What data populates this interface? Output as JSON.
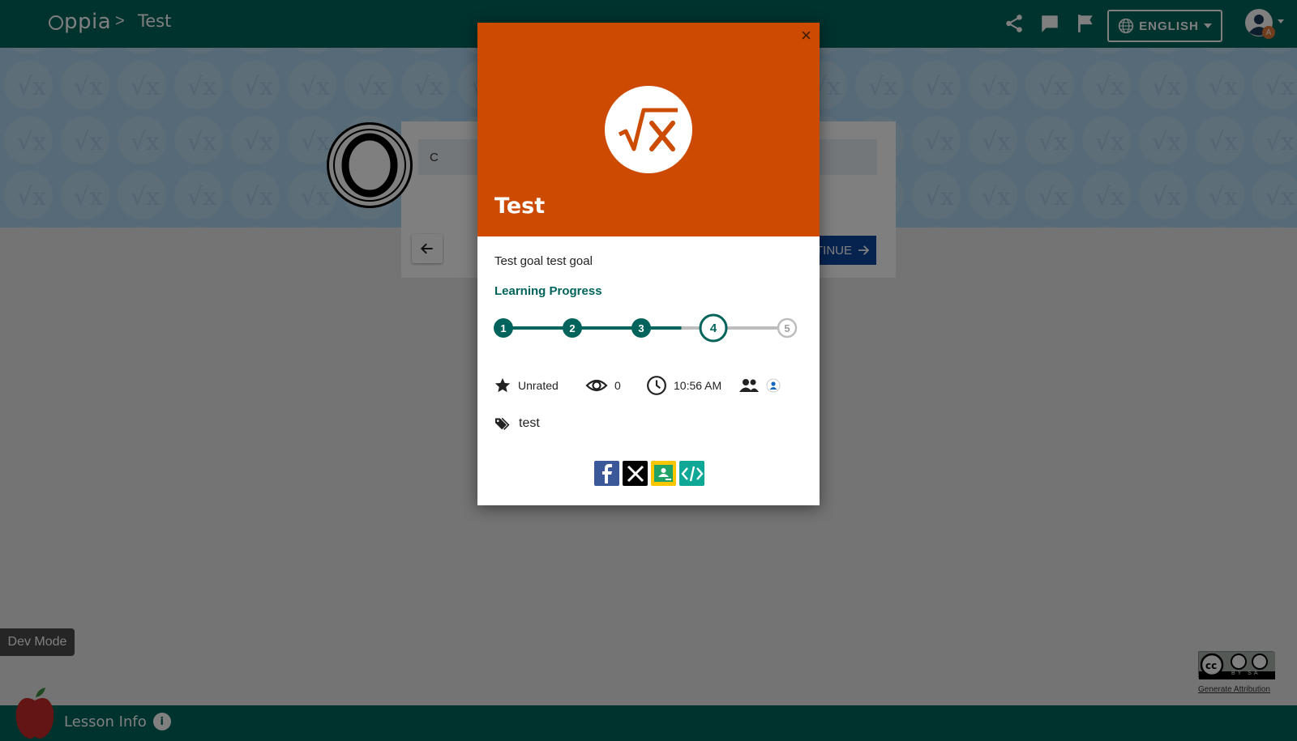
{
  "navbar": {
    "logo_text": "ppia",
    "breadcrumb_separator": ">",
    "exploration_title": "Test",
    "language_label": "ENGLISH",
    "avatar_badge": "A"
  },
  "background_card": {
    "input_value": "C",
    "continue_label": "TINUE"
  },
  "modal": {
    "title": "Test",
    "close_glyph": "×",
    "objective": "Test goal test goal",
    "progress_label": "Learning Progress",
    "steps": [
      "1",
      "2",
      "3",
      "4",
      "5"
    ],
    "completed_steps": 3,
    "current_step": 4,
    "rating": "Unrated",
    "views": "0",
    "last_updated": "10:56 AM",
    "tag": "test",
    "share_icons": [
      "facebook-icon",
      "x-twitter-icon",
      "google-classroom-icon",
      "embed-code-icon"
    ]
  },
  "dev_mode_label": "Dev Mode",
  "footer": {
    "lesson_info_label": "Lesson Info",
    "info_glyph": "i",
    "generate_attribution": "Generate Attribution",
    "license_badge_text": "BY SA"
  },
  "colors": {
    "primary": "#00645c",
    "header_orange": "#cc4b00",
    "continue_blue": "#0d47a1",
    "banner_blue": "#aed4ee"
  }
}
